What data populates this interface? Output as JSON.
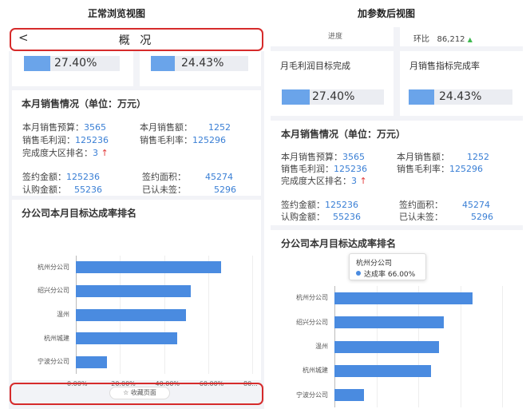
{
  "left_pane": {
    "caption": "正常浏览视图",
    "header": {
      "title": "概 况",
      "back_icon": "chevron-left-icon",
      "back_symbol": "<"
    },
    "progress": [
      {
        "value": "27.40%",
        "fill": 0.274
      },
      {
        "value": "24.43%",
        "fill": 0.2443
      }
    ],
    "sales": {
      "title": "本月销售情况（单位：万元）",
      "budget_label": "本月销售预算：",
      "budget_value": "3565",
      "amount_label": "本月销售额：",
      "amount_value": "1252",
      "gross_profit_label": "销售毛利润：",
      "gross_profit_value": "125236",
      "gross_margin_label": "销售毛利率：",
      "gross_margin_value": "125296",
      "rank_label": "完成度大区排名：",
      "rank_value": "3",
      "rank_arrow": "↑",
      "contract_amount_label": "签约金额：",
      "contract_amount_value": "125236",
      "contract_area_label": "签约面积：",
      "contract_area_value": "45274",
      "subscribe_label": "认购金额：",
      "subscribe_value": "55236",
      "unsigned_label": "已认未签：",
      "unsigned_value": "5296"
    },
    "footer": {
      "favorite_label": "收藏页面",
      "favorite_icon": "star-outline-icon",
      "star_symbol": "☆"
    }
  },
  "right_pane": {
    "caption": "加参数后视图",
    "top_row": {
      "progress_label": "进度",
      "mom_label": "环比",
      "mom_value": "86,212",
      "mom_arrow": "▲"
    },
    "target_cards": [
      {
        "title": "月毛利润目标完成",
        "value": "27.40%",
        "fill": 0.274
      },
      {
        "title": "月销售指标完成率",
        "value": "24.43%",
        "fill": 0.2443
      }
    ],
    "sales": {
      "title": "本月销售情况（单位：万元）",
      "budget_label": "本月销售预算：",
      "budget_value": "3565",
      "amount_label": "本月销售额：",
      "amount_value": "1252",
      "gross_profit_label": "销售毛利润：",
      "gross_profit_value": "125236",
      "gross_margin_label": "销售毛利率：",
      "gross_margin_value": "125296",
      "rank_label": "完成度大区排名：",
      "rank_value": "3",
      "rank_arrow": "↑",
      "contract_amount_label": "签约金额：",
      "contract_amount_value": "125236",
      "contract_area_label": "签约面积：",
      "contract_area_value": "45274",
      "subscribe_label": "认购金额：",
      "subscribe_value": "55236",
      "unsigned_label": "已认未签：",
      "unsigned_value": "5296"
    },
    "tooltip": {
      "category": "杭州分公司",
      "series_label": "达成率",
      "value": "66.00%"
    }
  },
  "chart_data": {
    "type": "bar",
    "orientation": "horizontal",
    "title": "分公司本月目标达成率排名",
    "categories": [
      "杭州分公司",
      "绍兴分公司",
      "温州",
      "杭州城建",
      "宁波分公司"
    ],
    "values": [
      66,
      52,
      50,
      46,
      14
    ],
    "xlim": [
      0,
      80
    ],
    "xticks": [
      "0.00%",
      "20.00%",
      "40.00%",
      "60.00%",
      "80..."
    ],
    "grid": true,
    "bar_color": "#4a8be0"
  }
}
